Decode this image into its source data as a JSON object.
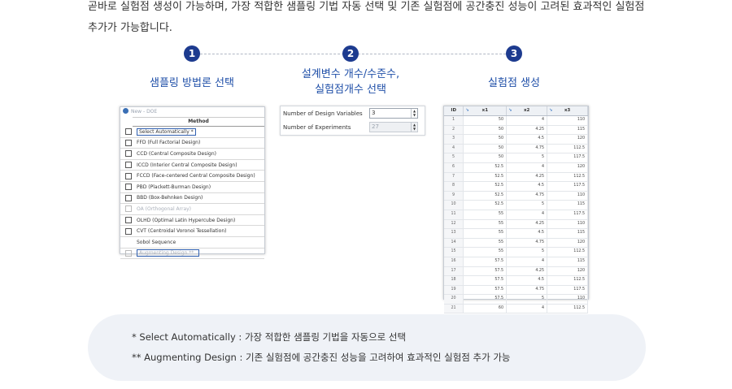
{
  "intro": {
    "line1": "곧바로 실험점 생성이 가능하며, 가장 적합한 샘플링 기법 자동 선택 및 기존 실험점에 공간충진 성능이 고려된 효과적인 실험점",
    "line2": "추가가 가능합니다."
  },
  "steps": [
    {
      "number": "1",
      "label_line1": "샘플링 방법론 선택",
      "label_line2": ""
    },
    {
      "number": "2",
      "label_line1": "설계변수 개수/수준수,",
      "label_line2": "실험점개수 선택"
    },
    {
      "number": "3",
      "label_line1": "실험점 생성",
      "label_line2": ""
    }
  ],
  "method_panel": {
    "title": "New - DOE",
    "header": "Method",
    "items": [
      {
        "label": "Select Automatically *",
        "state": "selected"
      },
      {
        "label": "FFD (Full Factorial Design)",
        "state": "normal"
      },
      {
        "label": "CCD (Central Composite Design)",
        "state": "normal"
      },
      {
        "label": "ICCD (Interior Central Composite Design)",
        "state": "normal"
      },
      {
        "label": "FCCD (Face-centered Central Composite Design)",
        "state": "normal"
      },
      {
        "label": "PBD (Plackett-Burman Design)",
        "state": "normal"
      },
      {
        "label": "BBD (Box-Behnken Design)",
        "state": "normal"
      },
      {
        "label": "OA (Orthogonal Array)",
        "state": "dim"
      },
      {
        "label": "OLHD (Optimal Latin Hypercube Design)",
        "state": "normal"
      },
      {
        "label": "CVT (Centroidal Voronoi Tessellation)",
        "state": "normal"
      },
      {
        "label": "Sobol Sequence",
        "state": "nobox"
      },
      {
        "label": "Augmenting Design **",
        "state": "aug"
      }
    ]
  },
  "variables_panel": {
    "design_variables_label": "Number of Design Variables",
    "design_variables_value": "3",
    "experiments_label": "Number of Experiments",
    "experiments_value": "27"
  },
  "table_panel": {
    "columns": [
      "ID",
      "x1",
      "x2",
      "x3"
    ],
    "rows": [
      [
        "1",
        "50",
        "4",
        "110"
      ],
      [
        "2",
        "50",
        "4.25",
        "115"
      ],
      [
        "3",
        "50",
        "4.5",
        "120"
      ],
      [
        "4",
        "50",
        "4.75",
        "112.5"
      ],
      [
        "5",
        "50",
        "5",
        "117.5"
      ],
      [
        "6",
        "52.5",
        "4",
        "120"
      ],
      [
        "7",
        "52.5",
        "4.25",
        "112.5"
      ],
      [
        "8",
        "52.5",
        "4.5",
        "117.5"
      ],
      [
        "9",
        "52.5",
        "4.75",
        "110"
      ],
      [
        "10",
        "52.5",
        "5",
        "115"
      ],
      [
        "11",
        "55",
        "4",
        "117.5"
      ],
      [
        "12",
        "55",
        "4.25",
        "110"
      ],
      [
        "13",
        "55",
        "4.5",
        "115"
      ],
      [
        "14",
        "55",
        "4.75",
        "120"
      ],
      [
        "15",
        "55",
        "5",
        "112.5"
      ],
      [
        "16",
        "57.5",
        "4",
        "115"
      ],
      [
        "17",
        "57.5",
        "4.25",
        "120"
      ],
      [
        "18",
        "57.5",
        "4.5",
        "112.5"
      ],
      [
        "19",
        "57.5",
        "4.75",
        "117.5"
      ],
      [
        "20",
        "57.5",
        "5",
        "110"
      ],
      [
        "21",
        "60",
        "4",
        "112.5"
      ]
    ]
  },
  "footnote": {
    "line1": "* Select Automatically : 가장 적합한 샘플링 기법을 자동으로 선택",
    "line2": "** Augmenting Design : 기존 실험점에  공간충진 성능을 고려하여 효과적인 실험점 추가 가능"
  },
  "colors": {
    "step_circle": "#1d3b8f",
    "step_label": "#1f4fa8",
    "note_bg": "#eff2f7"
  }
}
